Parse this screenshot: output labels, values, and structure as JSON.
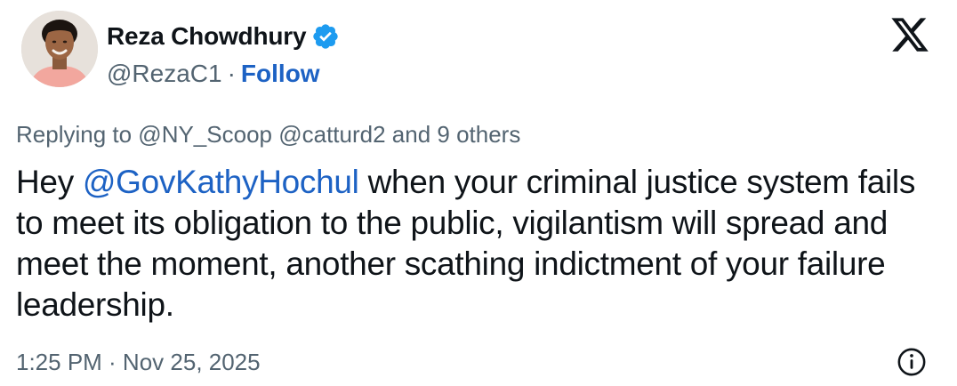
{
  "author": {
    "display_name": "Reza Chowdhury",
    "handle": "@RezaC1",
    "separator": "·",
    "follow_label": "Follow",
    "verified_badge_icon": "verified-badge-icon",
    "avatar": "avatar-photo"
  },
  "platform": {
    "logo_icon": "x-logo-icon"
  },
  "reply": {
    "text": "Replying to @NY_Scoop @catturd2 and 9 others"
  },
  "tweet": {
    "prefix": "Hey ",
    "mention": "@GovKathyHochul",
    "rest": " when your criminal justice system fails to meet its obligation to the public, vigilantism will spread and meet the moment, another scathing indictment of your failure leadership."
  },
  "footer": {
    "timestamp": "1:25 PM · Nov 25, 2025",
    "info_icon": "info-icon"
  },
  "colors": {
    "text_primary": "#0f1419",
    "text_secondary": "#536471",
    "link": "#1d62c4",
    "verified": "#1d9bf0"
  }
}
